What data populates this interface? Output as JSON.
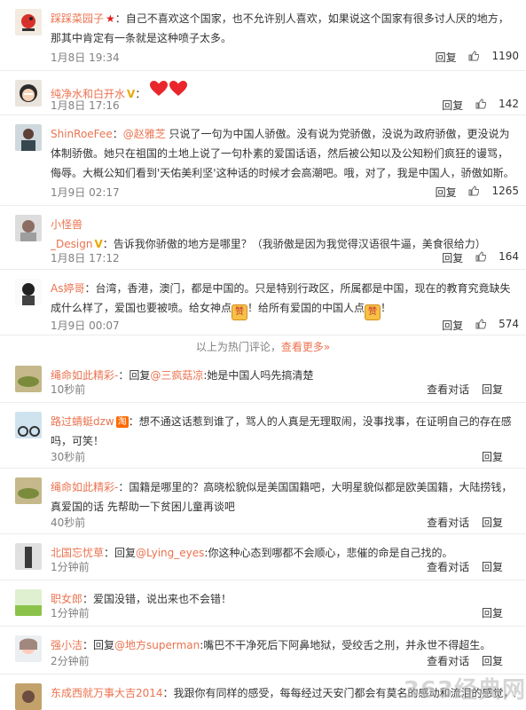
{
  "comments": [
    {
      "name": "踩踩菜园子",
      "text": "：自己不喜欢这个国家，也不允许别人喜欢，如果说这个国家有很多讨人厌的地方，那其中肯定有一条就是这种喷子太多。",
      "time": "1月8日 19:34",
      "reply": "回复",
      "likes": "1190"
    },
    {
      "name": "纯净水和白开水",
      "time": "1月8日 17:16",
      "reply": "回复",
      "likes": "142"
    },
    {
      "name": "ShinRoeFee",
      "mention": "@赵雅芝",
      "text": " 只说了一句为中国人骄傲。没有说为党骄傲，没说为政府骄傲，更没说为体制骄傲。她只在祖国的土地上说了一句朴素的爱国话语，然后被公知以及公知粉们疯狂的谩骂，侮辱。大概公知们看到'天佑美利坚'这种话的时候才会高潮吧。哦，对了，我是中国人，骄傲如斯。",
      "time": "1月9日 02:17",
      "reply": "回复",
      "likes": "1265"
    },
    {
      "name": "小怪兽_Design",
      "text": "：告诉我你骄傲的地方是哪里？（我骄傲是因为我觉得汉语很牛逼，美食很给力）",
      "time": "1月8日 17:12",
      "reply": "回复",
      "likes": "164"
    },
    {
      "name": "As婷哥",
      "text_a": "：台湾，香港，澳门，都是中国的。只是特别行政区，所属都是中国，现在的教育究竟缺失成什么样了，爱国也要被喷。给女神点",
      "text_b": "！给所有爱国的中国人点",
      "text_c": "！",
      "zan": "赞",
      "time": "1月9日 00:07",
      "reply": "回复",
      "likes": "574"
    }
  ],
  "separator": {
    "text": "以上为热门评论，",
    "link": "查看更多»"
  },
  "latest": [
    {
      "name": "绳命如此精彩-",
      "text_a": "：回复",
      "mention": "@三疯菇凉",
      "text_b": ":她是中国人吗先搞清楚",
      "time": "10秒前",
      "convo": "查看对话",
      "reply": "回复"
    },
    {
      "name": "路过蜻蜓dzw",
      "text": "：想不通这话惹到谁了，骂人的人真是无理取闹，没事找事，在证明自己的存在感吗，可笑！",
      "time": "30秒前",
      "reply": "回复"
    },
    {
      "name": "绳命如此精彩-",
      "text": "：国籍是哪里的？高晓松貌似是美国国籍吧，大明星貌似都是欧美国籍，大陆捞钱，真爱国的话 先帮助一下贫困儿童再谈吧",
      "time": "40秒前",
      "convo": "查看对话",
      "reply": "回复"
    },
    {
      "name": "北国忘忧草",
      "text_a": "：回复",
      "mention": "@Lying_eyes",
      "text_b": ":你这种心态到哪都不会顺心，悲催的命是自己找的。",
      "time": "1分钟前",
      "convo": "查看对话",
      "reply": "回复"
    },
    {
      "name": "职女郎",
      "text": "：爱国没错，说出来也不会错！",
      "time": "1分钟前",
      "reply": "回复"
    },
    {
      "name": "强小洁",
      "text_a": "：回复",
      "mention": "@地方superman",
      "text_b": ":嘴巴不干净死后下阿鼻地狱，受绞舌之刑，并永世不得超生。",
      "time": "2分钟前",
      "convo": "查看对话",
      "reply": "回复"
    },
    {
      "name": "东成西就万事大吉2014",
      "text": "：我跟你有同样的感受，每每经过天安门都会有莫名的感动和流泪的感觉，观"
    }
  ],
  "badge_text": "淘",
  "watermark": "363经典网",
  "colors": {
    "accent": "#eb7350",
    "meta": "#808080",
    "v": "#e8a800"
  }
}
